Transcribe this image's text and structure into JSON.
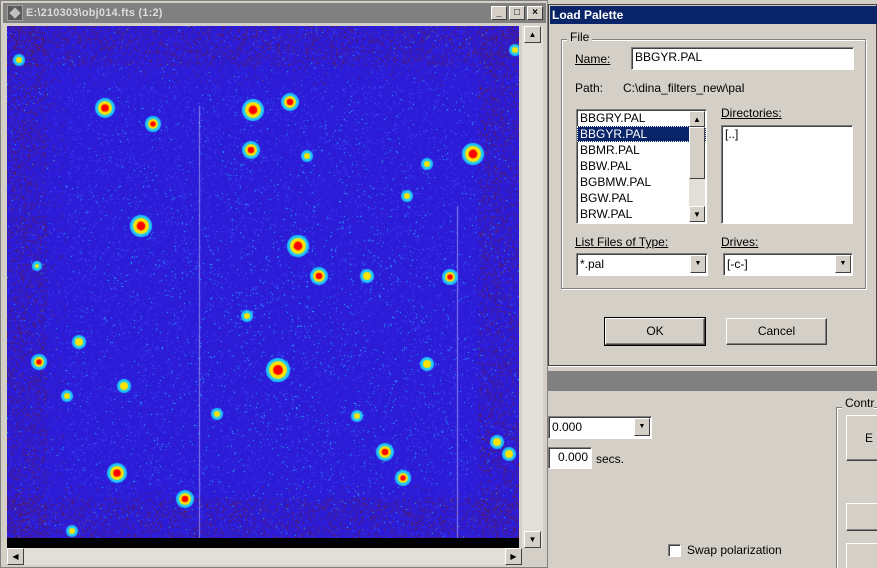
{
  "image_window": {
    "title": "E:\\210303\\obj014.fts (1:2)",
    "caption_buttons": {
      "minimize": "_",
      "maximize": "□",
      "close": "×"
    },
    "colors": {
      "background": "#2c1cd8",
      "noise_blue": "#3b50ff",
      "noise_cyan": "#1ec8ff",
      "noise_dark": "#5b1a52",
      "star_core": "#ff0000",
      "star_halo": "#ffe400"
    }
  },
  "dialog": {
    "title": "Load Palette",
    "file_group_label": "File",
    "name_label": "Name:",
    "name_value": "BBGYR.PAL",
    "path_label": "Path:",
    "path_value": "C:\\dina_filters_new\\pal",
    "files": [
      "BBGRY.PAL",
      "BBGYR.PAL",
      "BBMR.PAL",
      "BBW.PAL",
      "BGBMW.PAL",
      "BGW.PAL",
      "BRW.PAL"
    ],
    "selected_file": "BBGYR.PAL",
    "directories_label": "Directories:",
    "directories": [
      "[..]"
    ],
    "file_type_label": "List Files of Type:",
    "file_type_value": "*.pal",
    "drives_label": "Drives:",
    "drives_value": "[-c-]",
    "ok_label": "OK",
    "cancel_label": "Cancel"
  },
  "background_app": {
    "combo_value": "0.000",
    "secs_value": "0.000",
    "secs_label": "secs.",
    "swap_label": "Swap polarization",
    "control_group_label": "Contr",
    "button_fragment": "E"
  }
}
